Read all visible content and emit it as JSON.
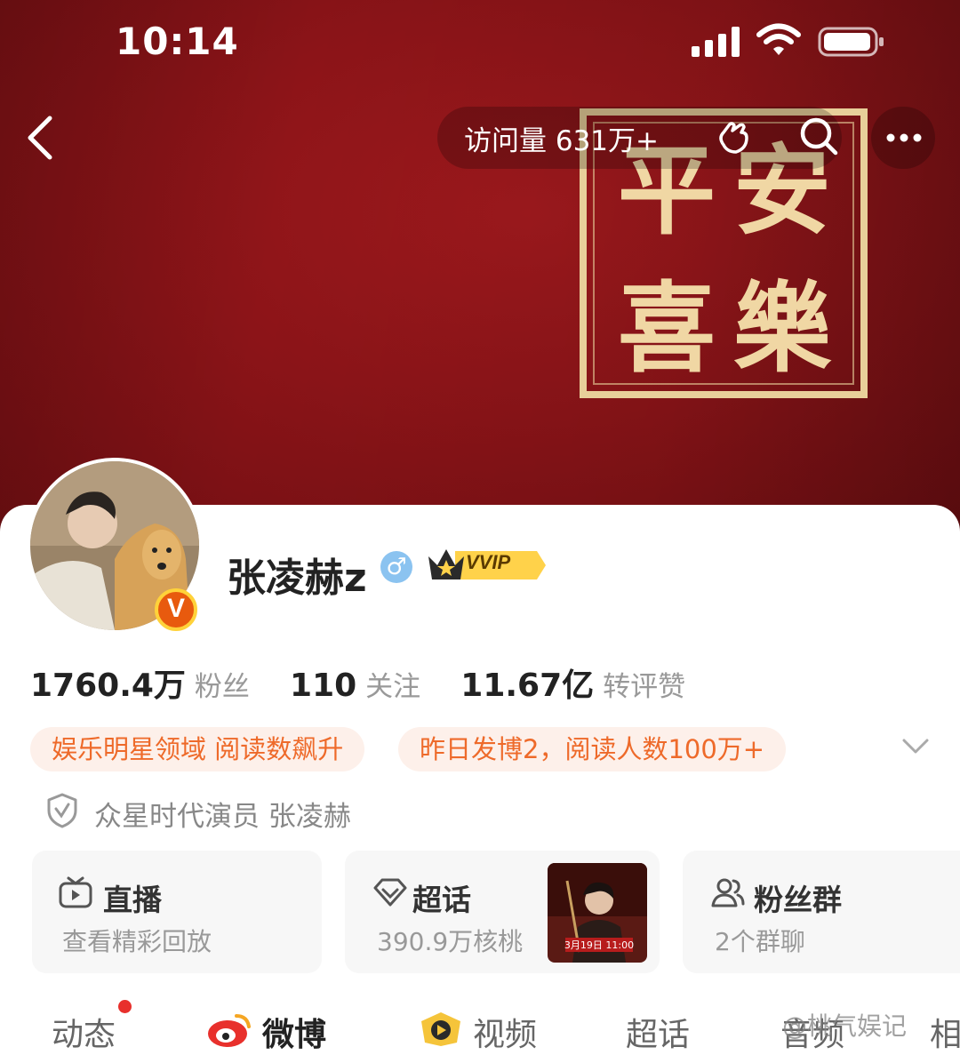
{
  "status_bar": {
    "time": "10:14"
  },
  "nav": {
    "visits": "访问量 631万+"
  },
  "cover": {
    "seal_chars": [
      "平",
      "安",
      "喜",
      "樂"
    ]
  },
  "profile": {
    "name": "张凌赫z",
    "gender_symbol": "♂",
    "vvip_label": "VVIP",
    "v_badge": "V"
  },
  "stats": [
    {
      "value": "1760.4万",
      "label": "粉丝"
    },
    {
      "value": "110",
      "label": "关注"
    },
    {
      "value": "11.67亿",
      "label": "转评赞"
    }
  ],
  "tags": [
    "娱乐明星领域 阅读数飙升",
    "昨日发博2，阅读人数100万+"
  ],
  "verification": "众星时代演员 张凌赫",
  "tiles": [
    {
      "title": "直播",
      "subtitle": "查看精彩回放"
    },
    {
      "title": "超话",
      "subtitle": "390.9万核桃"
    },
    {
      "title": "粉丝群",
      "subtitle": "2个群聊"
    }
  ],
  "poster": {
    "date_text": "3月19日 11:00"
  },
  "tabs": [
    "动态",
    "微博",
    "视频",
    "超话",
    "音频",
    "相"
  ],
  "watermark": "@桃气娱记"
}
